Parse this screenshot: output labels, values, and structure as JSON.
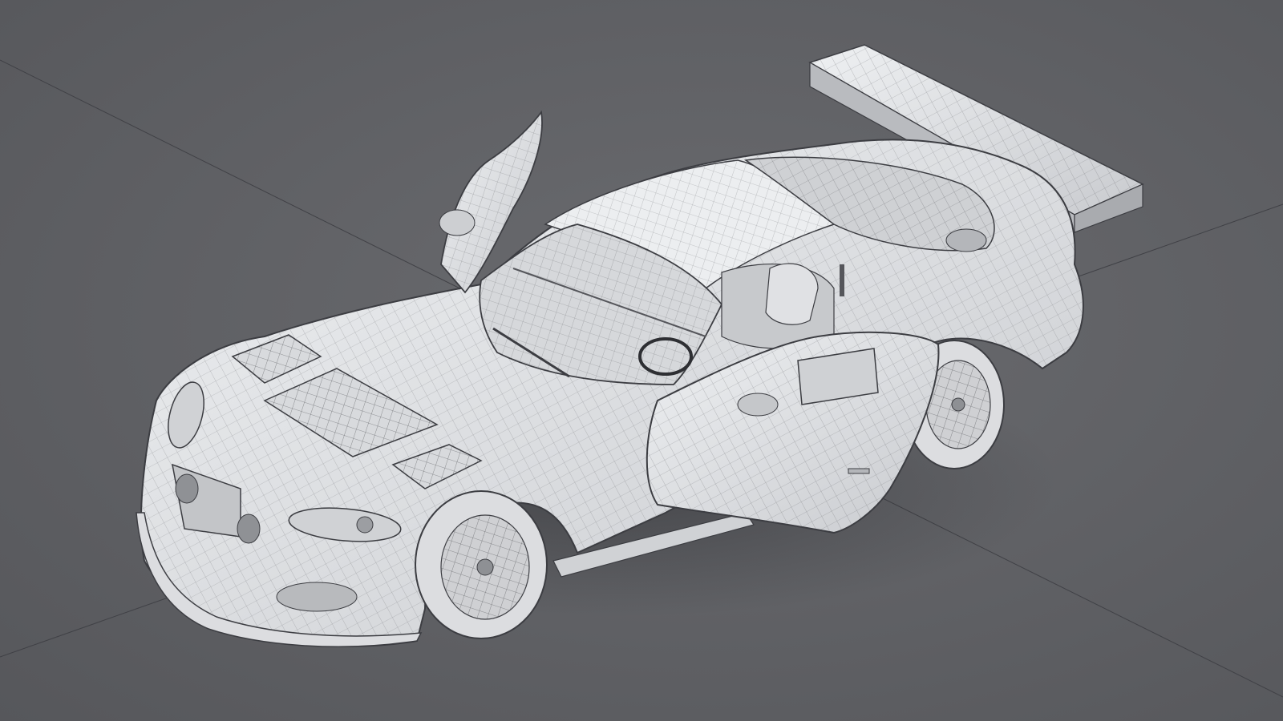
{
  "viewport": {
    "background_color": "#5f6064",
    "model_fill_color": "#e8e9ec",
    "wire_color": "#3c3d42",
    "grid_axis_color": "#404146"
  },
  "scene": {
    "subject": "wireframe-race-car-model",
    "parts": [
      "body",
      "hood-vents",
      "headlights",
      "front-splitter",
      "windshield",
      "roof",
      "rear-wing",
      "gullwing-door-left",
      "open-door-right",
      "front-wheel",
      "rear-wheel",
      "interior-seat",
      "steering-wheel",
      "roll-cage"
    ]
  }
}
